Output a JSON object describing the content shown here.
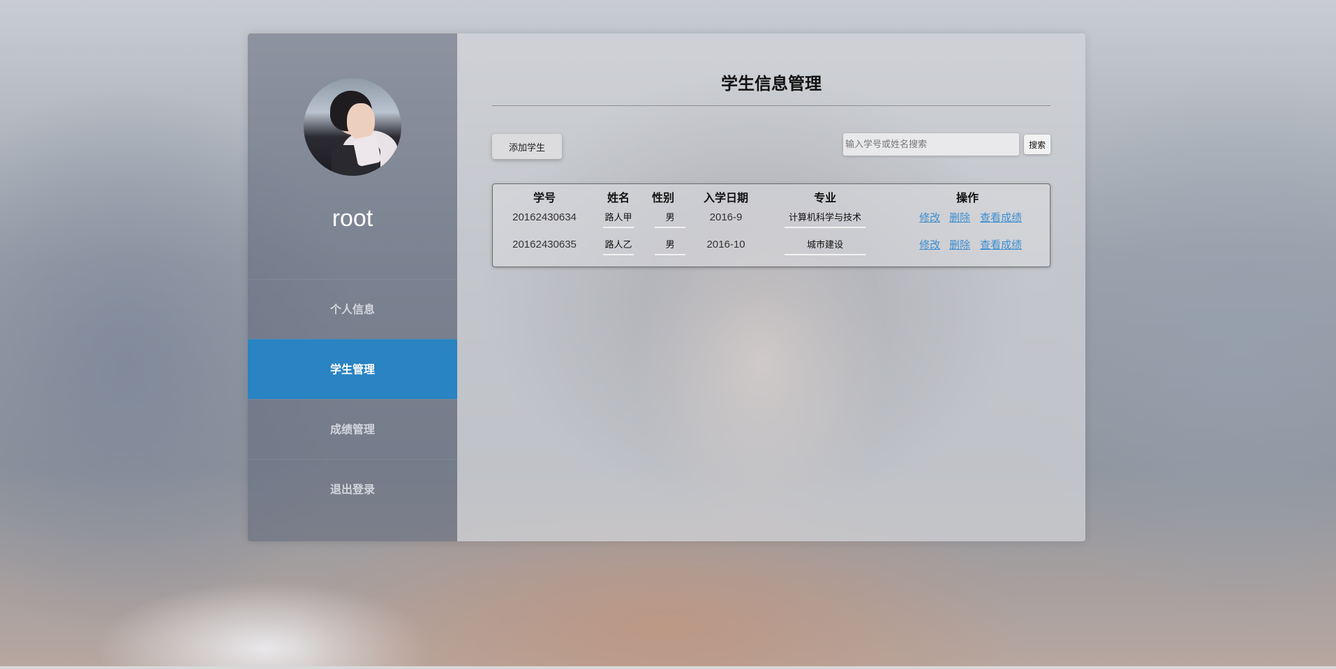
{
  "sidebar": {
    "username": "root",
    "nav": [
      {
        "label": "个人信息"
      },
      {
        "label": "学生管理"
      },
      {
        "label": "成绩管理"
      },
      {
        "label": "退出登录"
      }
    ],
    "active_index": 1
  },
  "main": {
    "title": "学生信息管理",
    "add_button": "添加学生",
    "search_placeholder": "输入学号或姓名搜索",
    "search_button": "搜索"
  },
  "table": {
    "headers": {
      "id": "学号",
      "name": "姓名",
      "gender": "性别",
      "date": "入学日期",
      "major": "专业",
      "actions": "操作"
    },
    "rows": [
      {
        "id": "20162430634",
        "name": "路人甲",
        "gender": "男",
        "date": "2016-9",
        "major": "计算机科学与技术",
        "edit": "修改",
        "delete": "删除",
        "grades": "查看成绩"
      },
      {
        "id": "20162430635",
        "name": "路人乙",
        "gender": "男",
        "date": "2016-10",
        "major": "城市建设",
        "edit": "修改",
        "delete": "删除",
        "grades": "查看成绩"
      }
    ]
  },
  "colors": {
    "active_nav": "#2a83c2",
    "link": "#3c8ed0"
  }
}
